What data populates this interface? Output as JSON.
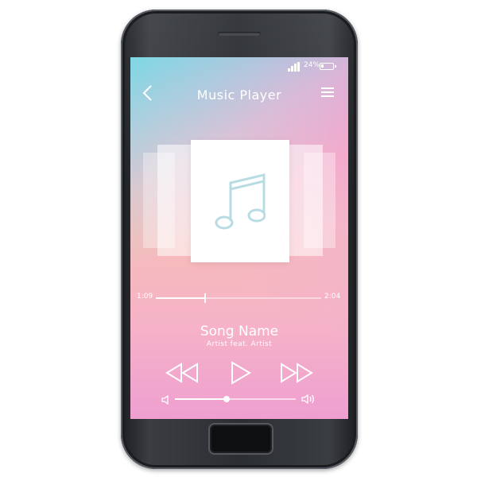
{
  "status_bar": {
    "battery_text": "24%",
    "battery_level": 0.24,
    "signal_icon": "signal-bars-icon",
    "battery_icon": "battery-icon"
  },
  "header": {
    "title": "Music Player",
    "back_icon": "chevron-left-icon",
    "menu_icon": "hamburger-menu-icon"
  },
  "album": {
    "art_icon": "music-note-icon"
  },
  "progress": {
    "elapsed": "1:09",
    "total": "2:04",
    "fraction": 0.3
  },
  "track_info": {
    "song_name": "Song Name",
    "artist": "Artist feat. Artist"
  },
  "controls": {
    "rewind_icon": "rewind-icon",
    "play_icon": "play-icon",
    "fast_forward_icon": "fast-forward-icon"
  },
  "volume": {
    "level": 0.43,
    "mute_icon": "volume-low-icon",
    "loud_icon": "volume-high-icon"
  },
  "colors": {
    "screen_gradient_top": "#78dae6",
    "screen_gradient_pink": "#ee9fd0",
    "screen_gradient_peach": "#f7bcb9",
    "foreground": "#ffffff",
    "phone_body": "#2b2e32"
  }
}
